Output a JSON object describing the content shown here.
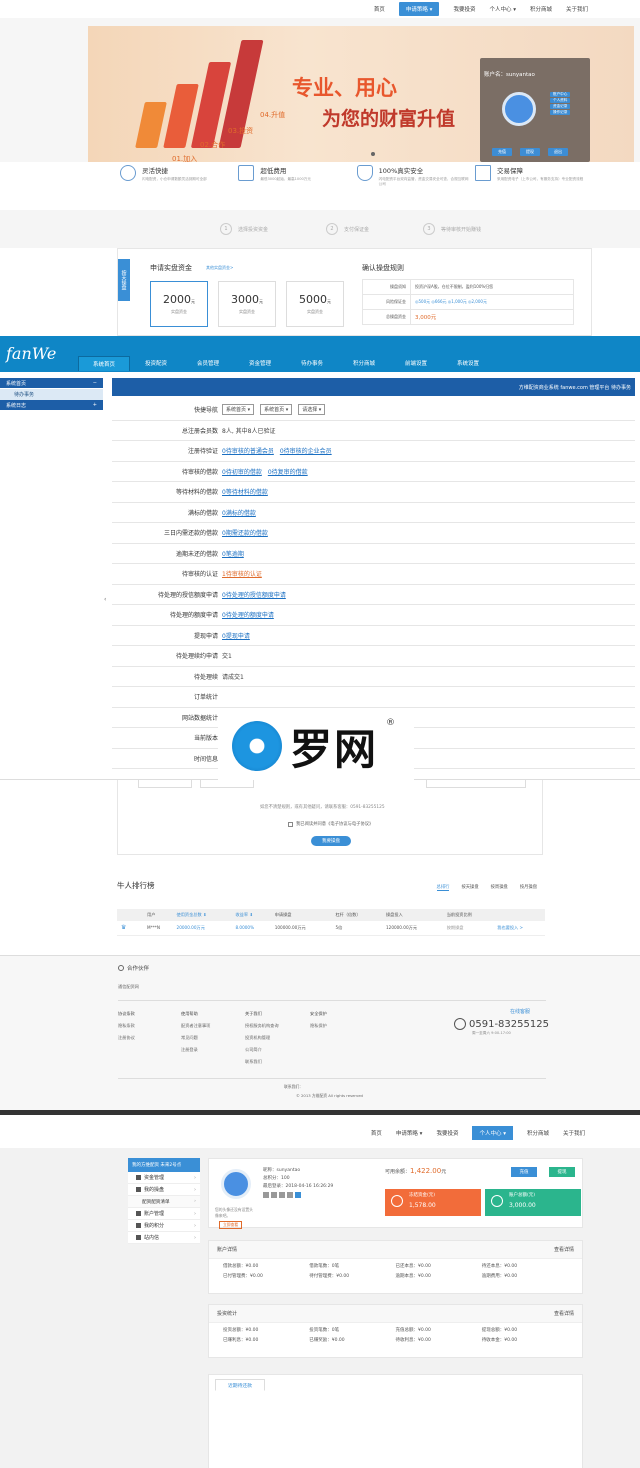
{
  "top_nav": {
    "items": [
      "首页",
      "申请策略 ▾",
      "我要投资",
      "个人中心 ▾",
      "积分商城",
      "关于我们"
    ]
  },
  "banner": {
    "slogan_1": "专业、用心",
    "slogan_2": "为您的财富升值",
    "steps": [
      "01.加入",
      "02.合作",
      "03.投资",
      "04.升值"
    ],
    "login": {
      "account_label": "账户名：sunyantao",
      "links": [
        "账户中心",
        "个人资料",
        "资金记录",
        "操作记录"
      ],
      "buttons": [
        "充值",
        "提现",
        "退出"
      ]
    }
  },
  "features": [
    {
      "title": "灵活快捷",
      "desc": "闪电配资，小仓申请数额灵活到期可全部"
    },
    {
      "title": "超低费用",
      "desc": "最低3000起始，最高1000万元"
    },
    {
      "title": "100%真实安全",
      "desc": "闪电配资平台双向监管，资金交易安全可查，合规互联网公司"
    },
    {
      "title": "交易保障",
      "desc": "采用配资电子（上市公司，有服务支持）专业配资流程"
    }
  ],
  "steps": [
    {
      "n": "1",
      "label": "选择投资资金"
    },
    {
      "n": "2",
      "label": "支付保证金"
    },
    {
      "n": "3",
      "label": "等待审核开始赚钱"
    }
  ],
  "apply": {
    "side_tab": "按天操盘",
    "title": "申请实盘资金",
    "sub_link": "其他实盘资金>",
    "amounts": [
      {
        "value": "2000",
        "unit": "元",
        "label": "实盘资金"
      },
      {
        "value": "3000",
        "unit": "元",
        "label": "实盘资金"
      },
      {
        "value": "5000",
        "unit": "元",
        "label": "实盘资金"
      }
    ],
    "rules_title": "确认操盘规则",
    "rules": [
      {
        "label": "操盘须知",
        "value": "投资沪深A股，仓位不限制，盈利100%归您"
      },
      {
        "label": "风险保证金",
        "value": "◎500元 ◎666元 ◎1,000元 ◎2,000元"
      },
      {
        "label": "总操盘资金",
        "value": "3,000元"
      }
    ]
  },
  "admin": {
    "logo": "fanWe",
    "menu": [
      "系统首页",
      "投资配资",
      "会员管理",
      "资金管理",
      "待办事务",
      "积分商城",
      "前端设置",
      "系统设置"
    ],
    "sidebar": [
      {
        "label": "系统首页",
        "sign": "−",
        "type": "head"
      },
      {
        "label": "待办事务",
        "type": "item"
      },
      {
        "label": "系统日志",
        "sign": "+",
        "type": "head"
      }
    ],
    "title_bar": "方维配资商业系统 fanwe.com 管理平台 待办事务",
    "quick_nav": {
      "label": "快捷导航",
      "selects": [
        "系统首页 ▾",
        "系统首页 ▾",
        "请选择 ▾"
      ]
    },
    "rows": [
      {
        "label": "总注册会员数",
        "text": "8人, 其中8人已验证",
        "links": []
      },
      {
        "label": "注册待验证",
        "text": "",
        "links": [
          "0待审核的普通会员",
          "0待审核的企业会员"
        ]
      },
      {
        "label": "待审核的借款",
        "text": "",
        "links": [
          "0待初审的借款",
          "0待复审的借款"
        ]
      },
      {
        "label": "等待材料的借款",
        "text": "",
        "links": [
          "0等待材料的借款"
        ]
      },
      {
        "label": "满标的借款",
        "text": "",
        "links": [
          "0满标的借款"
        ]
      },
      {
        "label": "三日内需还款的借款",
        "text": "",
        "links": [
          "0期需还款的借款"
        ]
      },
      {
        "label": "逾期未还的借款",
        "text": "",
        "links": [
          "0笔逾期"
        ]
      },
      {
        "label": "待审核的认证",
        "text": "",
        "links": [
          "1待审核的认证"
        ]
      },
      {
        "label": "待处理的授信额度申请",
        "text": "",
        "links": [
          "0待处理的授信额度申请"
        ]
      },
      {
        "label": "待处理的额度申请",
        "text": "",
        "links": [
          "0待处理的额度申请"
        ]
      },
      {
        "label": "提现申请",
        "text": "",
        "links": [
          "0提现申请"
        ]
      },
      {
        "label": "待处理续约申请",
        "text": "交1",
        "links": []
      },
      {
        "label": "待处理续",
        "text": "请成交1",
        "links": []
      },
      {
        "label": "订单统计",
        "text": "",
        "links": []
      },
      {
        "label": "网站数据统计",
        "text": "",
        "links": []
      },
      {
        "label": "当前版本",
        "text": "",
        "links": []
      },
      {
        "label": "时间信息",
        "text": "系统当前时间：2019-10-26 14:21:06",
        "links": []
      }
    ],
    "watermark": "罗网",
    "watermark_mark": "®"
  },
  "protocol": {
    "hint": "如您不清楚规则，或有其他疑问，请联系客服：0591-83255125",
    "agree": "我已阅读并同意《电子协议与电子协议》",
    "button": "我要操盘"
  },
  "ranking": {
    "title": "牛人排行榜",
    "tabs": [
      "总排行",
      "按天操盘",
      "按周操盘",
      "按月操盘"
    ],
    "headers": [
      "用户",
      "使用资金总数 ⬇",
      "收益率 ⬇",
      "申请操盘",
      "杠杆（倍数）",
      "操盘投入",
      "当前投资比例",
      ""
    ],
    "rows": [
      [
        "M***N",
        "20000.00万元",
        "8.0000%",
        "100000.00万元",
        "5倍",
        "120000.00万元",
        "按期操盘",
        "我也要投入 >"
      ]
    ]
  },
  "footer": {
    "partner_title": "合作伙伴",
    "partner_link": "通信配资网",
    "cols": [
      {
        "title": "协议条款",
        "items": [
          "隐私条款",
          "注册协议"
        ]
      },
      {
        "title": "使用帮助",
        "items": [
          "配资者注意事项",
          "常见问题",
          "注册登录"
        ]
      },
      {
        "title": "关于我们",
        "items": [
          "授权服务机构查询",
          "投资机构管理",
          "公司简介",
          "联系我们"
        ]
      },
      {
        "title": "安全保护",
        "items": [
          "隐私保护"
        ]
      }
    ],
    "service_label": "在线客服",
    "phone": "0591-83255125",
    "phone_hours": "周一至周六 9:00-17:00",
    "copyright_1": "联系我们：",
    "copyright_2": "© 2013 方维配资 All rights reserved"
  },
  "user_nav": {
    "items": [
      "首页",
      "申请策略 ▾",
      "我要投资",
      "个人中心 ▾",
      "积分商城",
      "关于我们"
    ]
  },
  "user_center": {
    "side_head": "我的方维配资 未来2号点",
    "side": [
      {
        "label": "资金管理",
        "sub": false
      },
      {
        "label": "我的操盘",
        "sub": false
      },
      {
        "label": "配资配资清单",
        "sub": true
      },
      {
        "label": "账户管理",
        "sub": false
      },
      {
        "label": "我的积分",
        "sub": false
      },
      {
        "label": "站内信",
        "sub": false
      }
    ],
    "nickname": "昵称：sunyantao",
    "points": "总积分：100",
    "last_login": "最后登录：2018-04-16 16:26:29",
    "avatar_hint": "您的头像还没有设置头像来吧。",
    "set_btn": "立即查看",
    "balance_label": "可用余额：",
    "balance": "1,422.00",
    "balance_unit": "元",
    "btn_recharge": "充值",
    "btn_withdraw": "提现",
    "box_orange": {
      "label": "冻结资金(元)",
      "value": "1,578.00"
    },
    "box_green": {
      "label": "账户总额(元)",
      "value": "3,000.00"
    },
    "detail_title": "账户详情",
    "detail_more": "查看详情",
    "detail": [
      "借款总额：¥0.00",
      "借款笔数：0笔",
      "已还本息：¥0.00",
      "待还本息：¥0.00",
      "已付管理费：¥0.00",
      "待付管理费：¥0.00",
      "逾期本息：¥0.00",
      "逾期费用：¥0.00"
    ],
    "invest_title": "投资统计",
    "invest_more": "查看详情",
    "invest": [
      "投资总额：¥0.00",
      "投资笔数：0笔",
      "充值总额：¥0.00",
      "提现总额：¥0.00",
      "已赚利息：¥0.00",
      "已赚奖励：¥0.00",
      "待收利息：¥0.00",
      "待收本金：¥0.00"
    ],
    "repay_tab": "近期待还款"
  }
}
